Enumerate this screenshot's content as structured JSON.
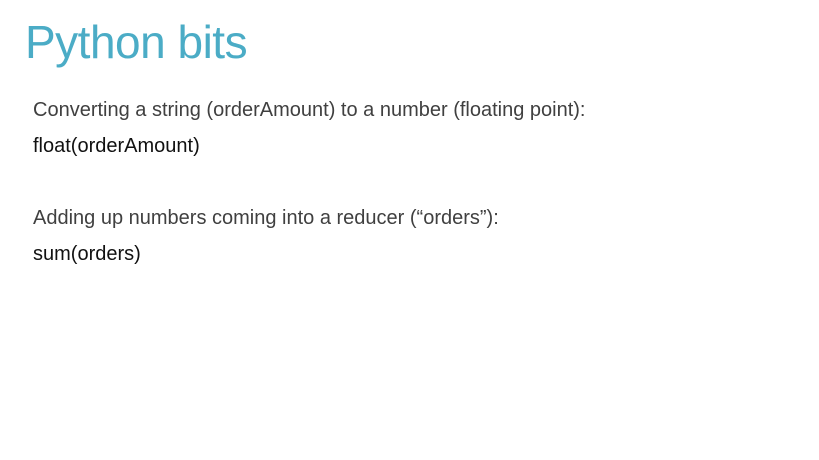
{
  "slide": {
    "title": "Python bits",
    "items": [
      {
        "description": "Converting a string (orderAmount) to a number (floating point):",
        "code": "float(orderAmount)"
      },
      {
        "description": "Adding up numbers coming into a reducer (“orders”):",
        "code": "sum(orders)"
      }
    ]
  },
  "colors": {
    "title": "#4bacc6",
    "body_text": "#404040",
    "code_text": "#111111",
    "background": "#ffffff"
  }
}
